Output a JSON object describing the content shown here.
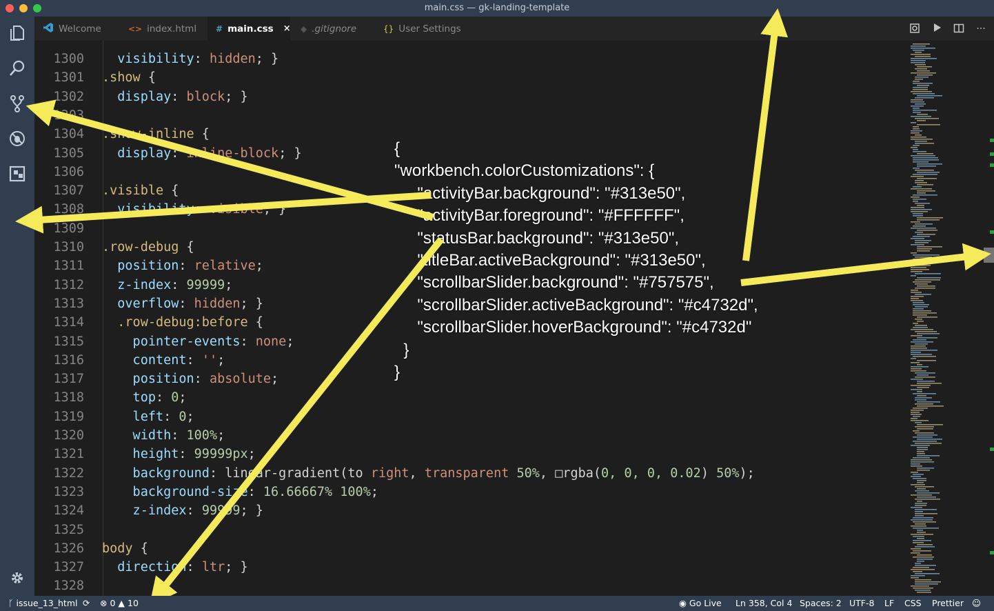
{
  "window": {
    "title": "main.css — gk-landing-template"
  },
  "activity_bar": {
    "items": [
      "files-icon",
      "search-icon",
      "source-control-icon",
      "debug-icon",
      "extensions-icon"
    ],
    "settings": "gear-icon"
  },
  "tabs": [
    {
      "label": "Welcome",
      "icon": "vscode-icon"
    },
    {
      "label": "index.html",
      "icon": "<>"
    },
    {
      "label": "main.css",
      "icon": "#",
      "active": true,
      "close": "×"
    },
    {
      "label": ".gitignore",
      "icon": "◆"
    },
    {
      "label": "User Settings",
      "icon": "{}"
    }
  ],
  "code": {
    "lines": [
      {
        "n": "1300",
        "parts": []
      },
      {
        "n": "1301",
        "parts": [
          {
            "t": ".show ",
            "c": "sel"
          },
          {
            "t": "{",
            "c": ""
          }
        ]
      },
      {
        "n": "1302",
        "parts": [
          {
            "t": "  display",
            "c": "prop"
          },
          {
            "t": ": ",
            "c": ""
          },
          {
            "t": "block",
            "c": "val"
          },
          {
            "t": "; }",
            "c": ""
          }
        ]
      },
      {
        "n": "1303",
        "parts": []
      },
      {
        "n": "1304",
        "parts": [
          {
            "t": ".show-inline ",
            "c": "sel"
          },
          {
            "t": "{",
            "c": ""
          }
        ]
      },
      {
        "n": "1305",
        "parts": [
          {
            "t": "  display",
            "c": "prop"
          },
          {
            "t": ": ",
            "c": ""
          },
          {
            "t": "inline-block",
            "c": "val"
          },
          {
            "t": "; }",
            "c": ""
          }
        ]
      },
      {
        "n": "1306",
        "parts": []
      },
      {
        "n": "1307",
        "parts": [
          {
            "t": ".visible ",
            "c": "sel"
          },
          {
            "t": "{",
            "c": ""
          }
        ]
      },
      {
        "n": "1308",
        "parts": [
          {
            "t": "  visibility",
            "c": "prop"
          },
          {
            "t": ": ",
            "c": ""
          },
          {
            "t": "visible",
            "c": "val"
          },
          {
            "t": "; }",
            "c": ""
          }
        ]
      },
      {
        "n": "1309",
        "parts": []
      },
      {
        "n": "1310",
        "parts": [
          {
            "t": ".row-debug ",
            "c": "sel"
          },
          {
            "t": "{",
            "c": ""
          }
        ]
      },
      {
        "n": "1311",
        "parts": [
          {
            "t": "  position",
            "c": "prop"
          },
          {
            "t": ": ",
            "c": ""
          },
          {
            "t": "relative",
            "c": "val"
          },
          {
            "t": ";",
            "c": ""
          }
        ]
      },
      {
        "n": "1312",
        "parts": [
          {
            "t": "  z-index",
            "c": "prop"
          },
          {
            "t": ": ",
            "c": ""
          },
          {
            "t": "99999",
            "c": "num"
          },
          {
            "t": ";",
            "c": ""
          }
        ]
      },
      {
        "n": "1313",
        "parts": [
          {
            "t": "  overflow",
            "c": "prop"
          },
          {
            "t": ": ",
            "c": ""
          },
          {
            "t": "hidden",
            "c": "val"
          },
          {
            "t": "; }",
            "c": ""
          }
        ]
      },
      {
        "n": "1314",
        "parts": [
          {
            "t": "  .row-debug:before ",
            "c": "sel"
          },
          {
            "t": "{",
            "c": ""
          }
        ]
      },
      {
        "n": "1315",
        "parts": [
          {
            "t": "    pointer-events",
            "c": "prop"
          },
          {
            "t": ": ",
            "c": ""
          },
          {
            "t": "none",
            "c": "val"
          },
          {
            "t": ";",
            "c": ""
          }
        ]
      },
      {
        "n": "1316",
        "parts": [
          {
            "t": "    content",
            "c": "prop"
          },
          {
            "t": ": ",
            "c": ""
          },
          {
            "t": "''",
            "c": "val"
          },
          {
            "t": ";",
            "c": ""
          }
        ]
      },
      {
        "n": "1317",
        "parts": [
          {
            "t": "    position",
            "c": "prop"
          },
          {
            "t": ": ",
            "c": ""
          },
          {
            "t": "absolute",
            "c": "val"
          },
          {
            "t": ";",
            "c": ""
          }
        ]
      },
      {
        "n": "1318",
        "parts": [
          {
            "t": "    top",
            "c": "prop"
          },
          {
            "t": ": ",
            "c": ""
          },
          {
            "t": "0",
            "c": "num"
          },
          {
            "t": ";",
            "c": ""
          }
        ]
      },
      {
        "n": "1319",
        "parts": [
          {
            "t": "    left",
            "c": "prop"
          },
          {
            "t": ": ",
            "c": ""
          },
          {
            "t": "0",
            "c": "num"
          },
          {
            "t": ";",
            "c": ""
          }
        ]
      },
      {
        "n": "1320",
        "parts": [
          {
            "t": "    width",
            "c": "prop"
          },
          {
            "t": ": ",
            "c": ""
          },
          {
            "t": "100%",
            "c": "num"
          },
          {
            "t": ";",
            "c": ""
          }
        ]
      },
      {
        "n": "1321",
        "parts": [
          {
            "t": "    height",
            "c": "prop"
          },
          {
            "t": ": ",
            "c": ""
          },
          {
            "t": "99999px",
            "c": "num"
          },
          {
            "t": ";",
            "c": ""
          }
        ]
      },
      {
        "n": "1322",
        "parts": [
          {
            "t": "    background",
            "c": "prop"
          },
          {
            "t": ": linear-gradient(to ",
            "c": ""
          },
          {
            "t": "right",
            "c": "val"
          },
          {
            "t": ", ",
            "c": ""
          },
          {
            "t": "transparent",
            "c": "val"
          },
          {
            "t": " ",
            "c": ""
          },
          {
            "t": "50%",
            "c": "num"
          },
          {
            "t": ", □rgba(",
            "c": ""
          },
          {
            "t": "0, 0, 0, 0.02",
            "c": "num"
          },
          {
            "t": ") ",
            "c": ""
          },
          {
            "t": "50%",
            "c": "num"
          },
          {
            "t": ");",
            "c": ""
          }
        ]
      },
      {
        "n": "1323",
        "parts": [
          {
            "t": "    background-size",
            "c": "prop"
          },
          {
            "t": ": ",
            "c": ""
          },
          {
            "t": "16.66667% 100%",
            "c": "num"
          },
          {
            "t": ";",
            "c": ""
          }
        ]
      },
      {
        "n": "1324",
        "parts": [
          {
            "t": "    z-index",
            "c": "prop"
          },
          {
            "t": ": ",
            "c": ""
          },
          {
            "t": "99999",
            "c": "num"
          },
          {
            "t": "; }",
            "c": ""
          }
        ]
      },
      {
        "n": "1325",
        "parts": []
      },
      {
        "n": "1326",
        "parts": [
          {
            "t": "body ",
            "c": "sel"
          },
          {
            "t": "{",
            "c": ""
          }
        ]
      },
      {
        "n": "1327",
        "parts": [
          {
            "t": "  direction",
            "c": "prop"
          },
          {
            "t": ": ",
            "c": ""
          },
          {
            "t": "ltr",
            "c": "val"
          },
          {
            "t": "; }",
            "c": ""
          }
        ]
      },
      {
        "n": "1328",
        "parts": []
      }
    ]
  },
  "overlay": {
    "lines": [
      "{",
      "\"workbench.colorCustomizations\": {",
      "     \"activityBar.background\": \"#313e50\",",
      "     \"activityBar.foreground\": \"#FFFFFF\",",
      "     \"statusBar.background\": \"#313e50\",",
      "     \"titleBar.activeBackground\": \"#313e50\",",
      "     \"scrollbarSlider.background\": \"#757575\",",
      "     \"scrollbarSlider.activeBackground\": \"#c4732d\",",
      "     \"scrollbarSlider.hoverBackground\": \"#c4732d\"",
      "  }",
      "}"
    ]
  },
  "status_bar": {
    "branch": "issue_13_html",
    "errors": "0",
    "warnings": "10",
    "go_live": "Go Live",
    "position": "Ln 358, Col 4",
    "spaces": "Spaces: 2",
    "encoding": "UTF-8",
    "eol": "LF",
    "language": "CSS",
    "formatter": "Prettier"
  },
  "colors": {
    "activity_bar": "#313e50",
    "status_bar": "#313e50",
    "title_bar": "#313e50",
    "scrollbar_slider": "#757575",
    "arrow": "#f5ea5a"
  }
}
